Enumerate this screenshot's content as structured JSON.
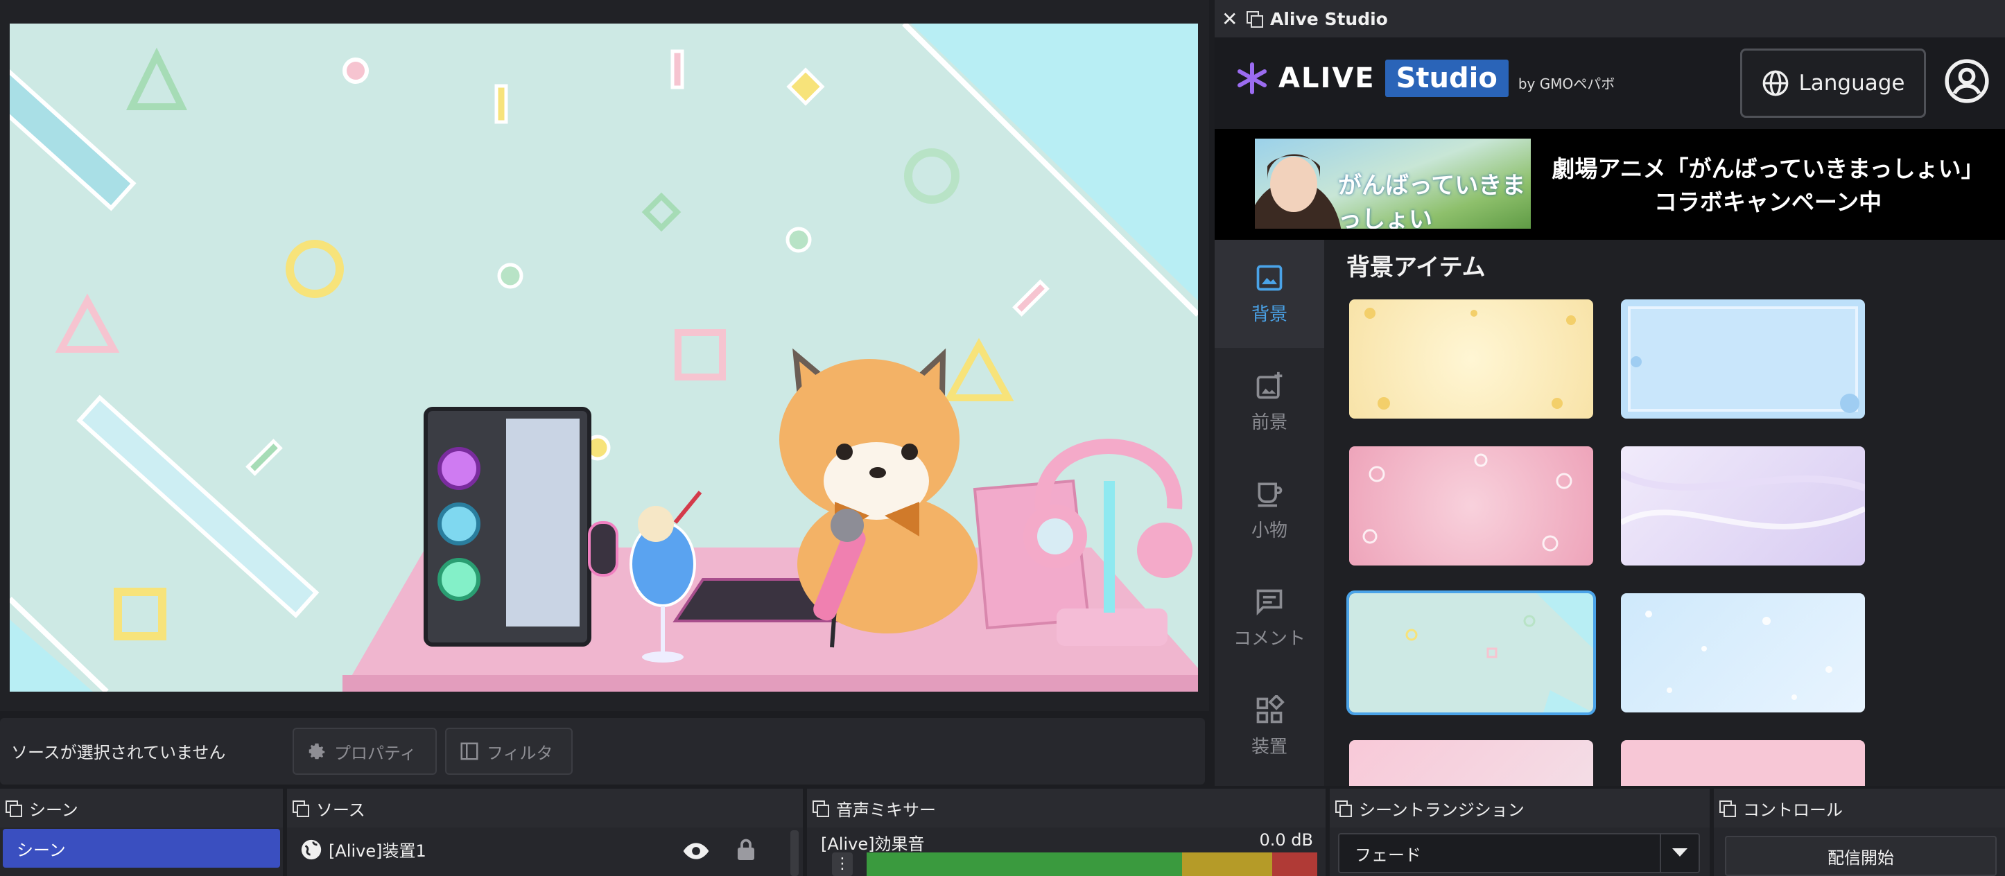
{
  "right_panel": {
    "window_title": "Alive Studio",
    "logo_alive": "ALIVE",
    "logo_studio": "Studio",
    "logo_by": "by GMOペパボ",
    "language_label": "Language",
    "banner_image_text": "がんばっていきまっしょい",
    "banner_title_line1": "劇場アニメ「がんばっていきまっしょい」",
    "banner_title_line2": "コラボキャンペーン中",
    "items_title": "背景アイテム"
  },
  "side_nav": [
    {
      "label": "背景",
      "icon": "image-icon",
      "active": true
    },
    {
      "label": "前景",
      "icon": "image-add-icon",
      "active": false
    },
    {
      "label": "小物",
      "icon": "cup-icon",
      "active": false
    },
    {
      "label": "コメント",
      "icon": "comment-icon",
      "active": false
    },
    {
      "label": "装置",
      "icon": "widgets-icon",
      "active": false
    }
  ],
  "source_bar": {
    "status": "ソースが選択されていません",
    "properties_label": "プロパティ",
    "filter_label": "フィルタ"
  },
  "docks": {
    "scene": {
      "title": "シーン",
      "item": "シーン"
    },
    "source": {
      "title": "ソース",
      "item": "[Alive]装置1"
    },
    "mixer": {
      "title": "音声ミキサー",
      "channel": "[Alive]効果音",
      "level": "0.0 dB"
    },
    "transition": {
      "title": "シーントランジション",
      "selected": "フェード"
    },
    "control": {
      "title": "コントロール",
      "start_label": "配信開始"
    }
  },
  "colors": {
    "accent": "#4aa3e8",
    "scene_selected": "#3a4fc0",
    "studio_badge": "#2a64b8"
  }
}
